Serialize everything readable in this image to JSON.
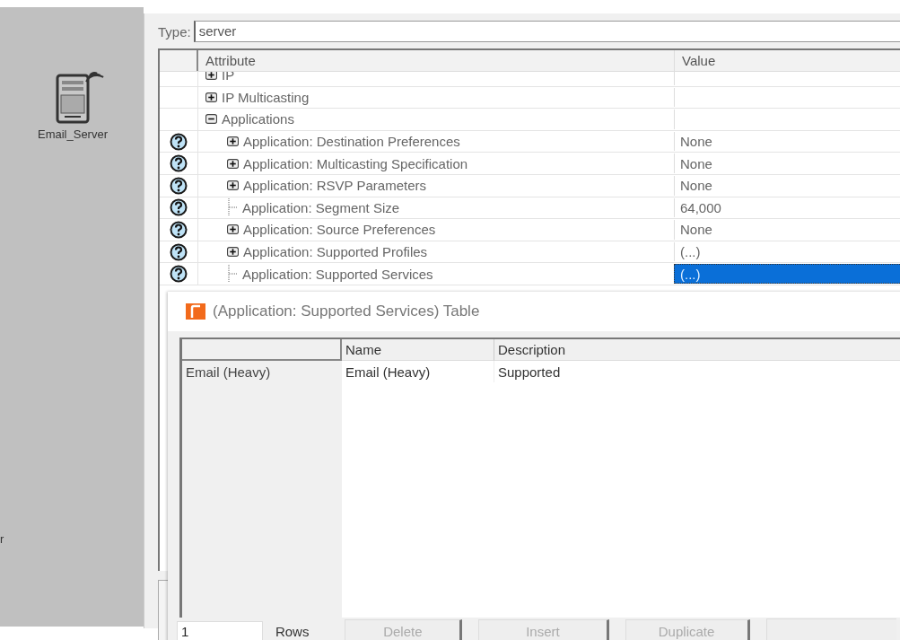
{
  "canvas": {
    "node_label": "Email_Server",
    "cut_label": "r"
  },
  "attributes": {
    "type_label": "Type:",
    "type_value": "server",
    "columns": [
      "Attribute",
      "Value"
    ],
    "rows": [
      {
        "label": "IP",
        "kind": "group",
        "expanded": false,
        "help": false,
        "selected": false
      },
      {
        "label": "IP Multicasting",
        "kind": "group",
        "expanded": false,
        "help": false,
        "selected": false
      },
      {
        "label": "Applications",
        "kind": "group",
        "expanded": true,
        "help": false,
        "selected": false,
        "children": [
          {
            "label": "Application: Destination Preferences",
            "value": "None",
            "kind": "group",
            "expanded": false,
            "help": true,
            "selected": false
          },
          {
            "label": "Application: Multicasting Specification",
            "value": "None",
            "kind": "group",
            "expanded": false,
            "help": true,
            "selected": false
          },
          {
            "label": "Application: RSVP Parameters",
            "value": "None",
            "kind": "group",
            "expanded": false,
            "help": true,
            "selected": false
          },
          {
            "label": "Application: Segment Size",
            "value": "64,000",
            "kind": "leaf",
            "help": true,
            "selected": false
          },
          {
            "label": "Application: Source Preferences",
            "value": "None",
            "kind": "group",
            "expanded": false,
            "help": true,
            "selected": false
          },
          {
            "label": "Application: Supported Profiles",
            "value": "(...)",
            "kind": "group",
            "expanded": false,
            "help": true,
            "selected": false
          },
          {
            "label": "Application: Supported Services",
            "value": "(...)",
            "kind": "leaf",
            "help": true,
            "selected": true
          }
        ]
      }
    ]
  },
  "table_dialog": {
    "title": "(Application: Supported Services) Table",
    "columns": [
      "Name",
      "Description"
    ],
    "rows": [
      {
        "header": "Email (Heavy)",
        "cells": [
          "Email (Heavy)",
          "Supported"
        ]
      }
    ],
    "row_count": "1",
    "rows_label": "Rows",
    "buttons": [
      {
        "label": "Delete",
        "disabled": true
      },
      {
        "label": "Insert",
        "disabled": true
      },
      {
        "label": "Duplicate",
        "disabled": true
      }
    ]
  }
}
